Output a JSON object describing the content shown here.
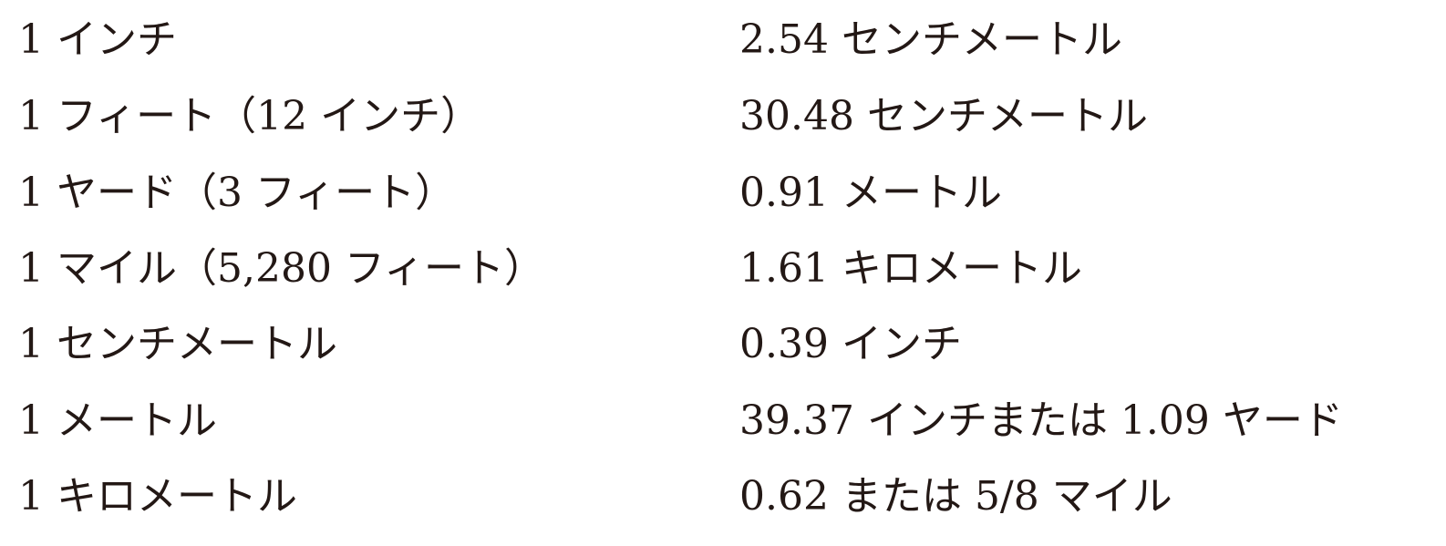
{
  "conversion_table": {
    "rows": [
      {
        "unit": "1 インチ",
        "equivalent": "2.54 センチメートル"
      },
      {
        "unit": "1 フィート（12 インチ）",
        "equivalent": "30.48 センチメートル"
      },
      {
        "unit": "1 ヤード（3 フィート）",
        "equivalent": "0.91 メートル"
      },
      {
        "unit": "1 マイル（5,280 フィート）",
        "equivalent": "1.61 キロメートル"
      },
      {
        "unit": "1 センチメートル",
        "equivalent": "0.39 インチ"
      },
      {
        "unit": "1 メートル",
        "equivalent": "39.37 インチまたは 1.09 ヤード"
      },
      {
        "unit": "1 キロメートル",
        "equivalent": "0.62 または 5/8 マイル"
      }
    ]
  },
  "colors": {
    "text": "#231815",
    "background": "#ffffff"
  }
}
